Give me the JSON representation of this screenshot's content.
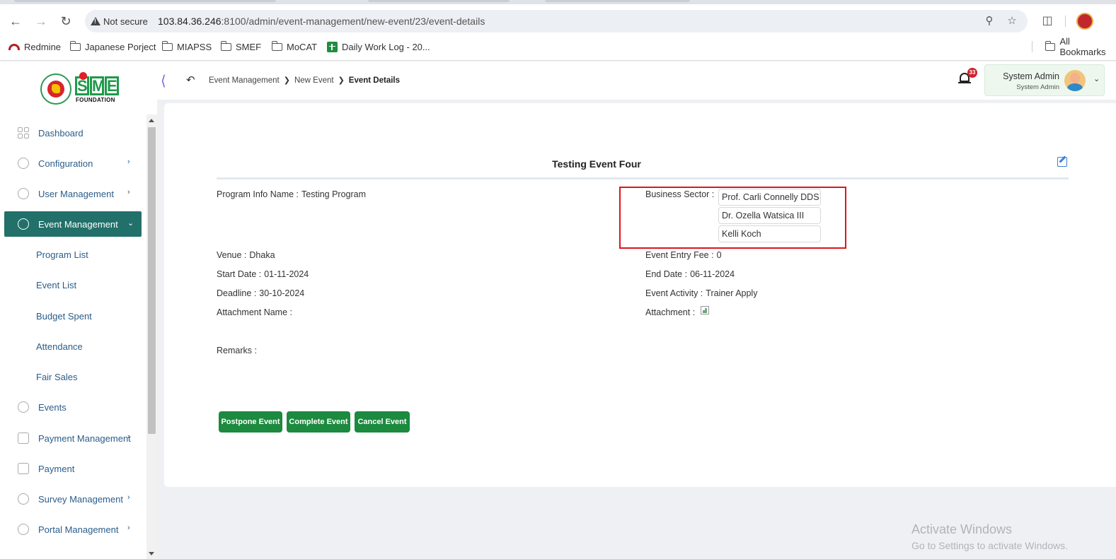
{
  "browser": {
    "security_label": "Not secure",
    "url_host": "103.84.36.246",
    "url_path": ":8100/admin/event-management/new-event/23/event-details",
    "bookmarks": [
      "Redmine",
      "Japanese Porject",
      "MIAPSS",
      "SMEF",
      "MoCAT",
      "Daily Work Log - 20..."
    ],
    "all_bookmarks": "All Bookmarks"
  },
  "logo": {
    "letters": [
      "S",
      "M",
      "E"
    ],
    "subtitle": "FOUNDATION"
  },
  "header": {
    "breadcrumbs": [
      "Event Management",
      "New Event",
      "Event Details"
    ],
    "notification_count": "33",
    "user_name": "System Admin",
    "user_role": "System Admin"
  },
  "sidebar": {
    "items": [
      {
        "label": "Dashboard",
        "icon": "dashboard-icon"
      },
      {
        "label": "Configuration",
        "icon": "configuration-icon"
      },
      {
        "label": "User Management",
        "icon": "user-management-icon"
      },
      {
        "label": "Event Management",
        "icon": "event-management-icon",
        "active": true
      },
      {
        "label": "Events",
        "icon": "events-icon"
      },
      {
        "label": "Payment Management",
        "icon": "payment-management-icon"
      },
      {
        "label": "Payment",
        "icon": "payment-icon"
      },
      {
        "label": "Survey Management",
        "icon": "survey-management-icon"
      },
      {
        "label": "Portal Management",
        "icon": "portal-management-icon"
      }
    ],
    "sub_items": [
      "Program List",
      "Event List",
      "Budget Spent",
      "Attendance",
      "Fair Sales"
    ]
  },
  "event": {
    "title": "Testing Event Four",
    "program_info_label": "Program Info Name :",
    "program_info_value": "Testing Program",
    "business_sector_label": "Business Sector :",
    "business_sectors": [
      "Prof. Carli Connelly DDS",
      "Dr. Ozella Watsica III",
      "Kelli Koch"
    ],
    "venue_label": "Venue :",
    "venue_value": "Dhaka",
    "entry_fee_label": "Event Entry Fee :",
    "entry_fee_value": "0",
    "start_date_label": "Start Date :",
    "start_date_value": "01-11-2024",
    "end_date_label": "End Date :",
    "end_date_value": "06-11-2024",
    "deadline_label": "Deadline :",
    "deadline_value": "30-10-2024",
    "activity_label": "Event Activity :",
    "activity_value": "Trainer Apply",
    "attachment_name_label": "Attachment Name :",
    "attachment_label": "Attachment :",
    "remarks_label": "Remarks :"
  },
  "actions": {
    "postpone": "Postpone Event",
    "complete": "Complete Event",
    "cancel": "Cancel Event"
  },
  "watermark": {
    "line1": "Activate Windows",
    "line2": "Go to Settings to activate Windows."
  },
  "colors": {
    "accent": "#22706a",
    "button": "#1c8a3f",
    "highlight": "#e0141e"
  }
}
